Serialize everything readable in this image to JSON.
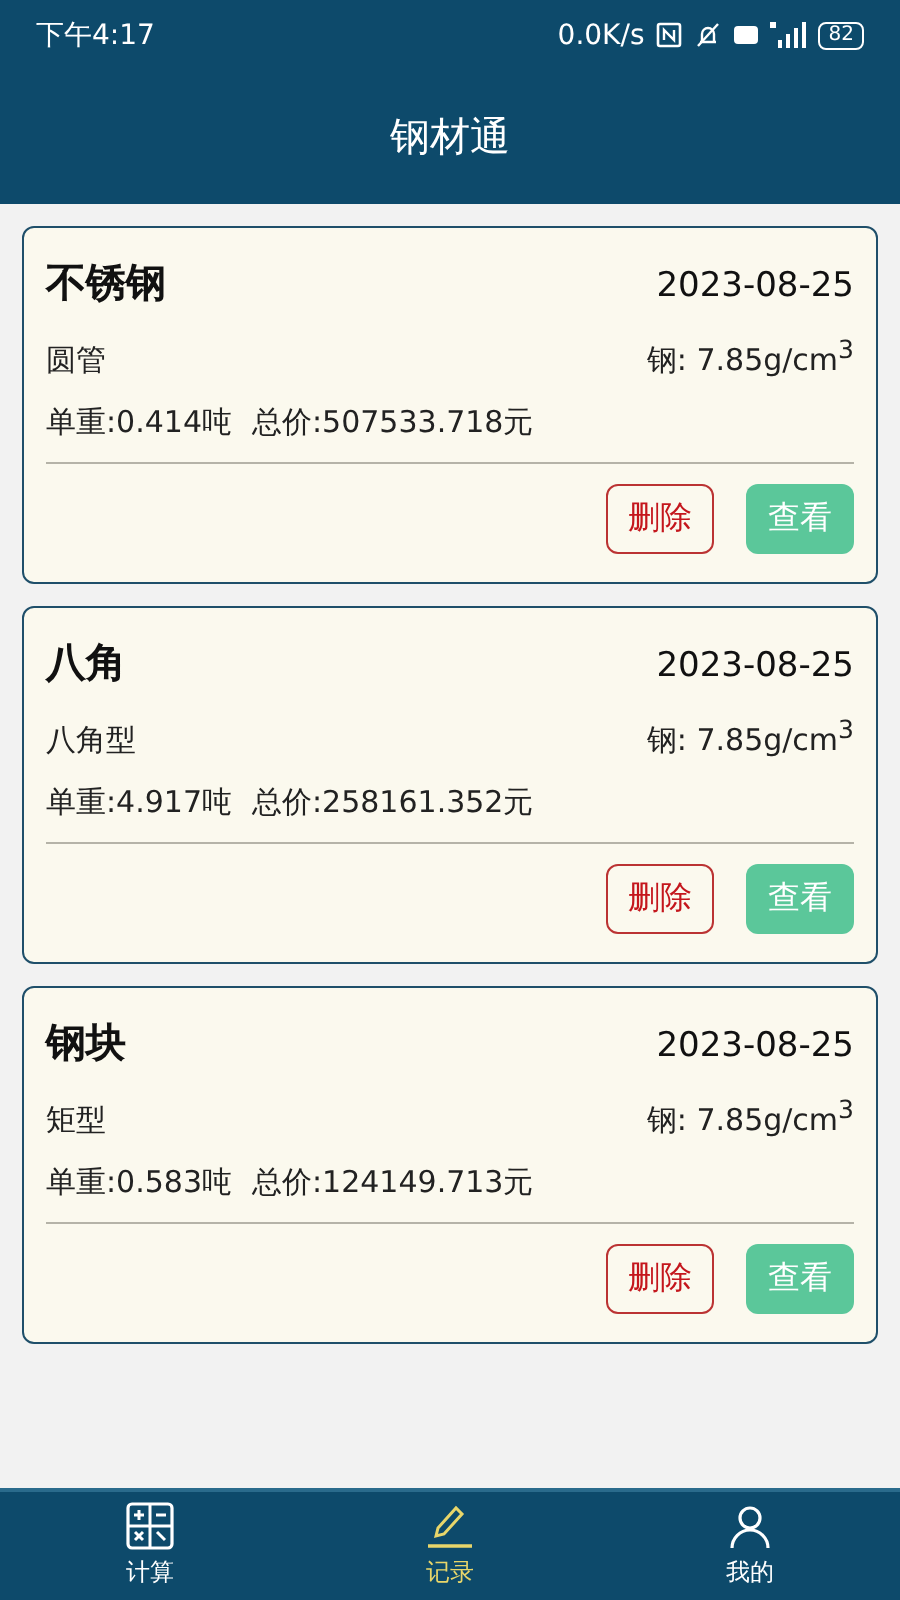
{
  "status_bar": {
    "time": "下午4:17",
    "speed": "0.0K/s",
    "battery": "82"
  },
  "title": "钢材通",
  "records": [
    {
      "name": "不锈钢",
      "date": "2023-08-25",
      "shape": "圆管",
      "density": "钢: 7.85g/cm$^{3}$",
      "weight": "单重:0.414吨",
      "price": "总价:507533.718元",
      "delete": "删除",
      "view": "查看"
    },
    {
      "name": "八角",
      "date": "2023-08-25",
      "shape": "八角型",
      "density": "钢: 7.85g/cm$^{3}$",
      "weight": "单重:4.917吨",
      "price": "总价:258161.352元",
      "delete": "删除",
      "view": "查看"
    },
    {
      "name": "钢块",
      "date": "2023-08-25",
      "shape": "矩型",
      "density": "钢: 7.85g/cm$^{3}$",
      "weight": "单重:0.583吨",
      "price": "总价:124149.713元",
      "delete": "删除",
      "view": "查看"
    }
  ],
  "tabs": [
    {
      "kind": "calc",
      "label": "计算",
      "selected": false
    },
    {
      "kind": "record",
      "label": "记录",
      "selected": true
    },
    {
      "kind": "me",
      "label": "我的",
      "selected": false
    }
  ]
}
